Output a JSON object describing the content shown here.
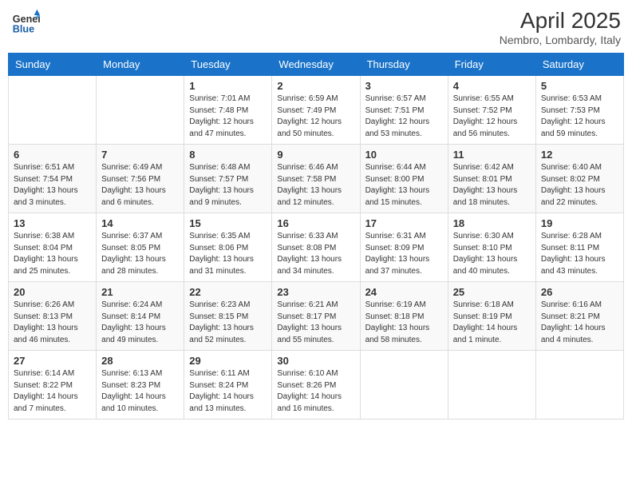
{
  "logo": {
    "line1": "General",
    "line2": "Blue"
  },
  "title": "April 2025",
  "subtitle": "Nembro, Lombardy, Italy",
  "weekdays": [
    "Sunday",
    "Monday",
    "Tuesday",
    "Wednesday",
    "Thursday",
    "Friday",
    "Saturday"
  ],
  "weeks": [
    [
      {
        "day": "",
        "sunrise": "",
        "sunset": "",
        "daylight": ""
      },
      {
        "day": "",
        "sunrise": "",
        "sunset": "",
        "daylight": ""
      },
      {
        "day": "1",
        "sunrise": "Sunrise: 7:01 AM",
        "sunset": "Sunset: 7:48 PM",
        "daylight": "Daylight: 12 hours and 47 minutes."
      },
      {
        "day": "2",
        "sunrise": "Sunrise: 6:59 AM",
        "sunset": "Sunset: 7:49 PM",
        "daylight": "Daylight: 12 hours and 50 minutes."
      },
      {
        "day": "3",
        "sunrise": "Sunrise: 6:57 AM",
        "sunset": "Sunset: 7:51 PM",
        "daylight": "Daylight: 12 hours and 53 minutes."
      },
      {
        "day": "4",
        "sunrise": "Sunrise: 6:55 AM",
        "sunset": "Sunset: 7:52 PM",
        "daylight": "Daylight: 12 hours and 56 minutes."
      },
      {
        "day": "5",
        "sunrise": "Sunrise: 6:53 AM",
        "sunset": "Sunset: 7:53 PM",
        "daylight": "Daylight: 12 hours and 59 minutes."
      }
    ],
    [
      {
        "day": "6",
        "sunrise": "Sunrise: 6:51 AM",
        "sunset": "Sunset: 7:54 PM",
        "daylight": "Daylight: 13 hours and 3 minutes."
      },
      {
        "day": "7",
        "sunrise": "Sunrise: 6:49 AM",
        "sunset": "Sunset: 7:56 PM",
        "daylight": "Daylight: 13 hours and 6 minutes."
      },
      {
        "day": "8",
        "sunrise": "Sunrise: 6:48 AM",
        "sunset": "Sunset: 7:57 PM",
        "daylight": "Daylight: 13 hours and 9 minutes."
      },
      {
        "day": "9",
        "sunrise": "Sunrise: 6:46 AM",
        "sunset": "Sunset: 7:58 PM",
        "daylight": "Daylight: 13 hours and 12 minutes."
      },
      {
        "day": "10",
        "sunrise": "Sunrise: 6:44 AM",
        "sunset": "Sunset: 8:00 PM",
        "daylight": "Daylight: 13 hours and 15 minutes."
      },
      {
        "day": "11",
        "sunrise": "Sunrise: 6:42 AM",
        "sunset": "Sunset: 8:01 PM",
        "daylight": "Daylight: 13 hours and 18 minutes."
      },
      {
        "day": "12",
        "sunrise": "Sunrise: 6:40 AM",
        "sunset": "Sunset: 8:02 PM",
        "daylight": "Daylight: 13 hours and 22 minutes."
      }
    ],
    [
      {
        "day": "13",
        "sunrise": "Sunrise: 6:38 AM",
        "sunset": "Sunset: 8:04 PM",
        "daylight": "Daylight: 13 hours and 25 minutes."
      },
      {
        "day": "14",
        "sunrise": "Sunrise: 6:37 AM",
        "sunset": "Sunset: 8:05 PM",
        "daylight": "Daylight: 13 hours and 28 minutes."
      },
      {
        "day": "15",
        "sunrise": "Sunrise: 6:35 AM",
        "sunset": "Sunset: 8:06 PM",
        "daylight": "Daylight: 13 hours and 31 minutes."
      },
      {
        "day": "16",
        "sunrise": "Sunrise: 6:33 AM",
        "sunset": "Sunset: 8:08 PM",
        "daylight": "Daylight: 13 hours and 34 minutes."
      },
      {
        "day": "17",
        "sunrise": "Sunrise: 6:31 AM",
        "sunset": "Sunset: 8:09 PM",
        "daylight": "Daylight: 13 hours and 37 minutes."
      },
      {
        "day": "18",
        "sunrise": "Sunrise: 6:30 AM",
        "sunset": "Sunset: 8:10 PM",
        "daylight": "Daylight: 13 hours and 40 minutes."
      },
      {
        "day": "19",
        "sunrise": "Sunrise: 6:28 AM",
        "sunset": "Sunset: 8:11 PM",
        "daylight": "Daylight: 13 hours and 43 minutes."
      }
    ],
    [
      {
        "day": "20",
        "sunrise": "Sunrise: 6:26 AM",
        "sunset": "Sunset: 8:13 PM",
        "daylight": "Daylight: 13 hours and 46 minutes."
      },
      {
        "day": "21",
        "sunrise": "Sunrise: 6:24 AM",
        "sunset": "Sunset: 8:14 PM",
        "daylight": "Daylight: 13 hours and 49 minutes."
      },
      {
        "day": "22",
        "sunrise": "Sunrise: 6:23 AM",
        "sunset": "Sunset: 8:15 PM",
        "daylight": "Daylight: 13 hours and 52 minutes."
      },
      {
        "day": "23",
        "sunrise": "Sunrise: 6:21 AM",
        "sunset": "Sunset: 8:17 PM",
        "daylight": "Daylight: 13 hours and 55 minutes."
      },
      {
        "day": "24",
        "sunrise": "Sunrise: 6:19 AM",
        "sunset": "Sunset: 8:18 PM",
        "daylight": "Daylight: 13 hours and 58 minutes."
      },
      {
        "day": "25",
        "sunrise": "Sunrise: 6:18 AM",
        "sunset": "Sunset: 8:19 PM",
        "daylight": "Daylight: 14 hours and 1 minute."
      },
      {
        "day": "26",
        "sunrise": "Sunrise: 6:16 AM",
        "sunset": "Sunset: 8:21 PM",
        "daylight": "Daylight: 14 hours and 4 minutes."
      }
    ],
    [
      {
        "day": "27",
        "sunrise": "Sunrise: 6:14 AM",
        "sunset": "Sunset: 8:22 PM",
        "daylight": "Daylight: 14 hours and 7 minutes."
      },
      {
        "day": "28",
        "sunrise": "Sunrise: 6:13 AM",
        "sunset": "Sunset: 8:23 PM",
        "daylight": "Daylight: 14 hours and 10 minutes."
      },
      {
        "day": "29",
        "sunrise": "Sunrise: 6:11 AM",
        "sunset": "Sunset: 8:24 PM",
        "daylight": "Daylight: 14 hours and 13 minutes."
      },
      {
        "day": "30",
        "sunrise": "Sunrise: 6:10 AM",
        "sunset": "Sunset: 8:26 PM",
        "daylight": "Daylight: 14 hours and 16 minutes."
      },
      {
        "day": "",
        "sunrise": "",
        "sunset": "",
        "daylight": ""
      },
      {
        "day": "",
        "sunrise": "",
        "sunset": "",
        "daylight": ""
      },
      {
        "day": "",
        "sunrise": "",
        "sunset": "",
        "daylight": ""
      }
    ]
  ]
}
